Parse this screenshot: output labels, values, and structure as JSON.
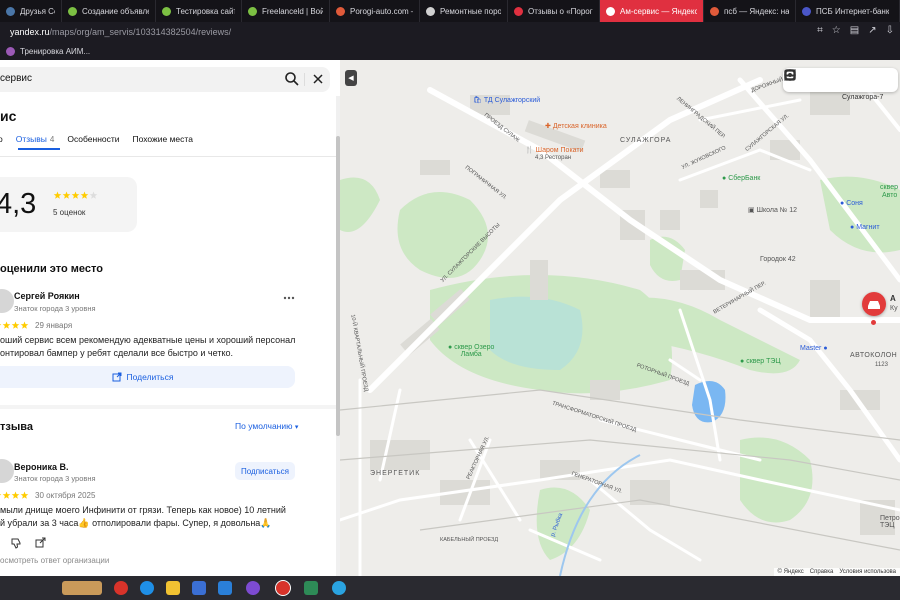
{
  "browser": {
    "tabs": [
      {
        "label": "Друзья Сергей Р",
        "color": "#4a76a8",
        "active": false
      },
      {
        "label": "Создание объявле",
        "color": "#7cc043",
        "active": false
      },
      {
        "label": "Тестировка сайтов",
        "color": "#7cc043",
        "active": false
      },
      {
        "label": "Freelanceld | Войти",
        "color": "#7cc043",
        "active": false
      },
      {
        "label": "Porogi-auto.com —",
        "color": "#e05a3a",
        "active": false
      },
      {
        "label": "Ремонтные пороги",
        "color": "#d0d0d0",
        "active": false
      },
      {
        "label": "Отзывы о «Пороги-",
        "color": "#e03040",
        "active": false
      },
      {
        "label": "Ам-сервис — Яндекс Ка",
        "color": "#ffffff",
        "active": true
      },
      {
        "label": "псб — Яндекс: наш",
        "color": "#e05a3a",
        "active": false
      },
      {
        "label": "ПСБ Интернет-банк",
        "color": "#4a56c8",
        "active": false
      }
    ],
    "url_host": "yandex.ru",
    "url_path": "/maps/org/am_servis/103314382504/reviews/",
    "bookmarks": [
      {
        "label": "Тренировка АИМ..."
      }
    ]
  },
  "panel": {
    "search_value": "сервис",
    "org_title": "ис",
    "tabs": [
      {
        "label": "о",
        "count": ""
      },
      {
        "label": "Отзывы",
        "count": "4"
      },
      {
        "label": "Особенности",
        "count": ""
      },
      {
        "label": "Похожие места",
        "count": ""
      }
    ],
    "rating": {
      "value": "4,3",
      "stars": 4.3,
      "count_label": "5 оценок"
    },
    "rated_title": "оценили это место",
    "review1": {
      "name": "Сергей Роякин",
      "level": "Знаток города 3 уровня",
      "date": "29 января",
      "stars": 5,
      "text_line1": "оший сервис всем рекомендую адекватные цены и хороший персонал",
      "text_line2": "онтировал бампер у ребят сделали все быстро и четко."
    },
    "share_label": "Поделиться",
    "reviews_title": "тзыва",
    "sort_label": "По умолчанию",
    "review2": {
      "name": "Вероника В.",
      "level": "Знаток города 3 уровня",
      "subscribe_label": "Подписаться",
      "date": "30 октября 2025",
      "stars": 5,
      "text_line1": "мыли днище моего Инфинити от грязи. Теперь как новое) 10 летний",
      "text_line2": "й убрали за 3 часа👍 отполировали фары. Супер, я довольна🙏"
    },
    "owner_reply": "осмотреть ответ организации"
  },
  "map": {
    "labels": {
      "td": "ТД Сулажгорский",
      "clinic": "Детская клиника",
      "sharom": "Шаром Покати",
      "sharom_sub": "4,3 Ресторан",
      "sulazhgora": "СУЛАЖГОРА",
      "sberbank": "СберБанк",
      "school": "Школа № 12",
      "gorodok": "Городок 42",
      "sonya": "Соня",
      "magnit": "Магнит",
      "skver_avto": "сквер",
      "skver_avto2": "Авто",
      "lake": "сквер Озеро",
      "lake2": "Ламба",
      "master": "Master",
      "skver_tec": "сквер ТЭЦ",
      "avtokolonna": "АВТОКОЛОН",
      "energetik": "ЭНЕРГЕТИК",
      "petro": "Петро",
      "petro2": "ТЭЦ",
      "rybka": "р. Рыбка",
      "pin_label": "А",
      "pin_label2": "Ку",
      "sulazhgora7": "Сулажгора-7",
      "num1123": "1123",
      "street_pogranichnaya": "ПОГРАНИЧНАЯ УЛ.",
      "street_sulazh_vysoty": "УЛ. СУЛАЖГОРСКИЕ ВЫСОТЫ",
      "street_transformator": "ТРАНСФОРМАТОРСКИЙ ПРОЕЗД",
      "street_generator": "ГЕНЕРАТОРНАЯ УЛ.",
      "street_reaktor": "РЕАКТОРНАЯ УЛ.",
      "street_kabel": "КАБЕЛЬНЫЙ ПРОЕЗД",
      "street_rotor": "РОТОРНЫЙ ПРОЕЗД",
      "street_veterinar": "ВЕТЕРИНАРНЫЙ ПЕР.",
      "street_sulazhgor": "СУЛАЖГОРСКАЯ УЛ.",
      "street_zhukovsky": "УЛ. ЖУКОВСКОГО",
      "street_dorozhny": "ДОРОЖНЫЙ ПЕР.",
      "street_leningrad": "ЛЕНИНГРАДСКИЙ ПЕР.",
      "street_kvartal": "10-Й КВАРТАЛЬНЫЙ ПРОЕЗД",
      "street_sulazh_pr": "ПРОЕЗД СУЛАЖ"
    },
    "footer": [
      "© Яндекс",
      "Справка",
      "Условия использова"
    ]
  }
}
